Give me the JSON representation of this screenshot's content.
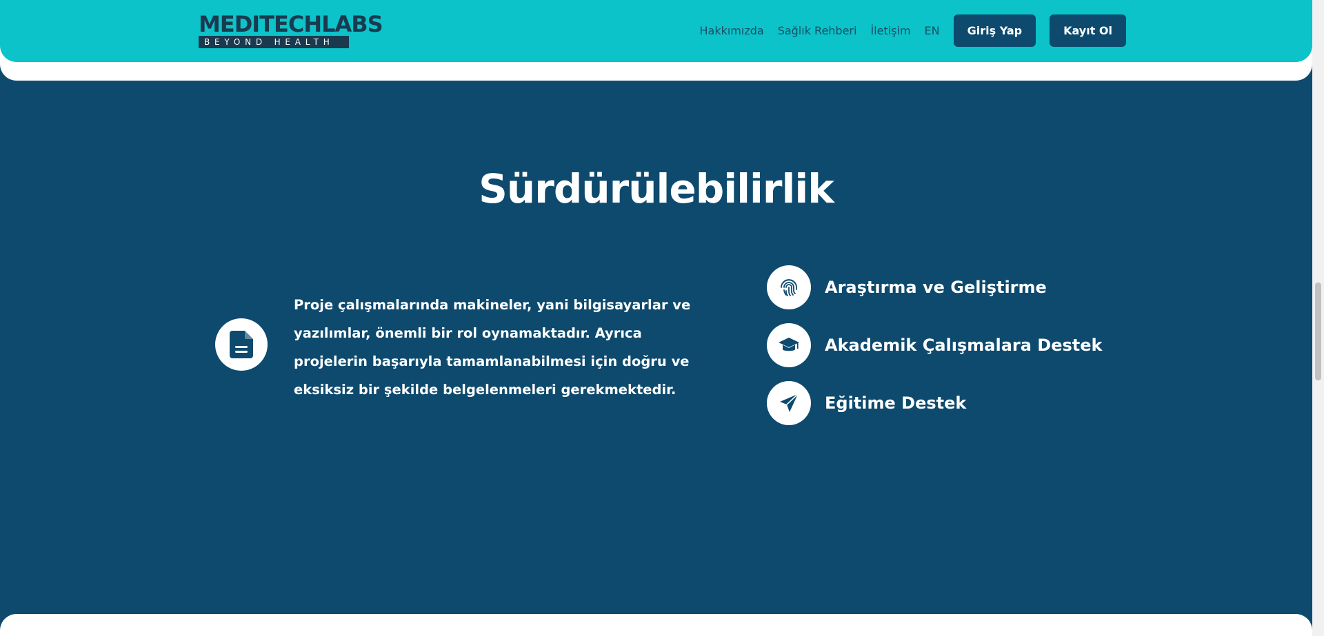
{
  "header": {
    "logo_text": "MEDITECHLABS",
    "logo_tagline": "BEYOND HEALTH",
    "nav": [
      {
        "label": "Hakkımızda"
      },
      {
        "label": "Sağlık Rehberi"
      },
      {
        "label": "İletişim"
      },
      {
        "label": "EN"
      }
    ],
    "login_label": "Giriş Yap",
    "register_label": "Kayıt Ol"
  },
  "section": {
    "title": "Sürdürülebilirlik",
    "description": "Proje çalışmalarında makineler, yani bilgisayarlar ve yazılımlar, önemli bir rol oynamaktadır. Ayrıca projelerin başarıyla tamamlanabilmesi için doğru ve eksiksiz bir şekilde belgelenmeleri gerekmektedir.",
    "description_icon": "document-icon",
    "features": [
      {
        "label": "Araştırma ve Geliştirme",
        "icon": "fingerprint-icon"
      },
      {
        "label": "Akademik Çalışmalara Destek",
        "icon": "graduation-cap-icon"
      },
      {
        "label": "Eğitime Destek",
        "icon": "paper-plane-icon"
      }
    ]
  },
  "colors": {
    "header_bg": "#0bc3c9",
    "section_bg": "#0d4a6e",
    "button_bg": "#0d4a6e",
    "logo_dark": "#1a3a4f"
  }
}
